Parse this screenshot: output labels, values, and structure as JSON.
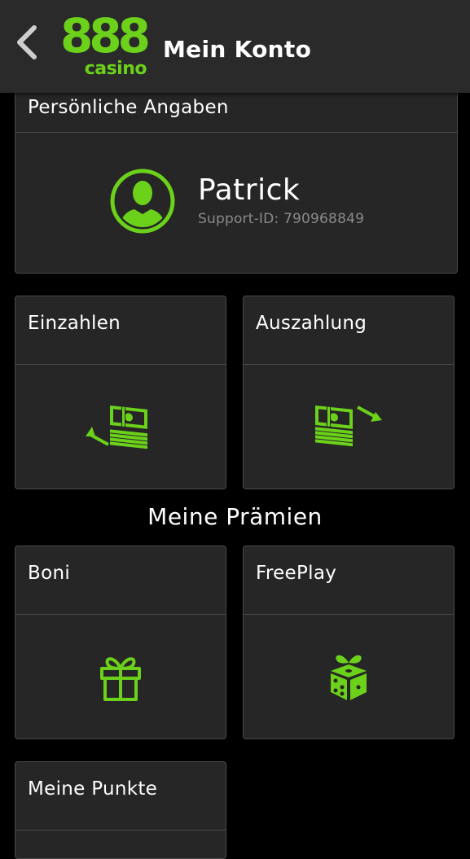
{
  "header": {
    "title": "Mein Konto",
    "logo_number": "888",
    "logo_word": "casino"
  },
  "profile": {
    "section_label": "Persönliche Angaben",
    "name": "Patrick",
    "support_id": "Support-ID: 790968849"
  },
  "tiles": {
    "deposit": "Einzahlen",
    "withdraw": "Auszahlung",
    "bonus": "Boni",
    "freeplay": "FreePlay",
    "points": "Meine Punkte"
  },
  "rewards_title": "Meine Prämien",
  "colors": {
    "accent": "#6bd11a",
    "background": "#000000",
    "card": "#262626",
    "header": "#2a2a2a"
  }
}
